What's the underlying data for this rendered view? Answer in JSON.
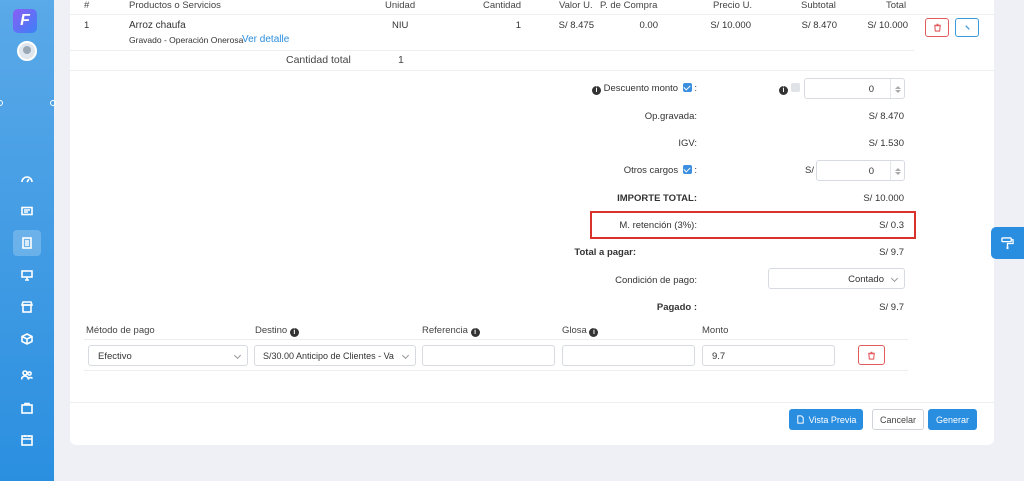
{
  "table": {
    "headers": {
      "num": "#",
      "product": "Productos o Servicios",
      "unit": "Unidad",
      "qty": "Cantidad",
      "value": "Valor U.",
      "purchase": "P. de Compra",
      "price": "Precio U.",
      "subtotal": "Subtotal",
      "total": "Total"
    },
    "row": {
      "num": "1",
      "product": "Arroz chaufa",
      "detail": "Gravado - Operación Onerosa",
      "link": "Ver detalle",
      "unit": "NIU",
      "qty": "1",
      "value": "S/ 8.475",
      "purchase": "0.00",
      "price": "S/ 10.000",
      "subtotal": "S/ 8.470",
      "total": "S/ 10.000"
    },
    "qty_total_label": "Cantidad total",
    "qty_total_value": "1"
  },
  "summary": {
    "discount_label": "Descuento monto",
    "discount_value": "0",
    "op_gravada_label": "Op.gravada:",
    "op_gravada_value": "S/ 8.470",
    "igv_label": "IGV:",
    "igv_value": "S/ 1.530",
    "other_label": "Otros cargos",
    "other_currency": "S/",
    "other_value": "0",
    "importe_label": "IMPORTE TOTAL:",
    "importe_value": "S/ 10.000",
    "retencion_label": "M. retención (3%):",
    "retencion_value": "S/ 0.3",
    "total_pagar_label": "Total a pagar:",
    "total_pagar_value": "S/ 9.7",
    "condicion_label": "Condición de pago:",
    "condicion_value": "Contado",
    "pagado_label": "Pagado :",
    "pagado_value": "S/ 9.7"
  },
  "payment": {
    "headers": {
      "method": "Método de pago",
      "dest": "Destino",
      "ref": "Referencia",
      "glosa": "Glosa",
      "monto": "Monto"
    },
    "method_value": "Efectivo",
    "dest_value": "S/30.00 Anticipo de Clientes - Va",
    "ref_value": "",
    "glosa_value": "",
    "monto_value": "9.7"
  },
  "footer": {
    "preview": "Vista Previa",
    "cancel": "Cancelar",
    "generate": "Generar"
  },
  "colors": {
    "accent": "#2a8ee0",
    "highlight": "#d9312b",
    "danger": "#e25c5c"
  }
}
